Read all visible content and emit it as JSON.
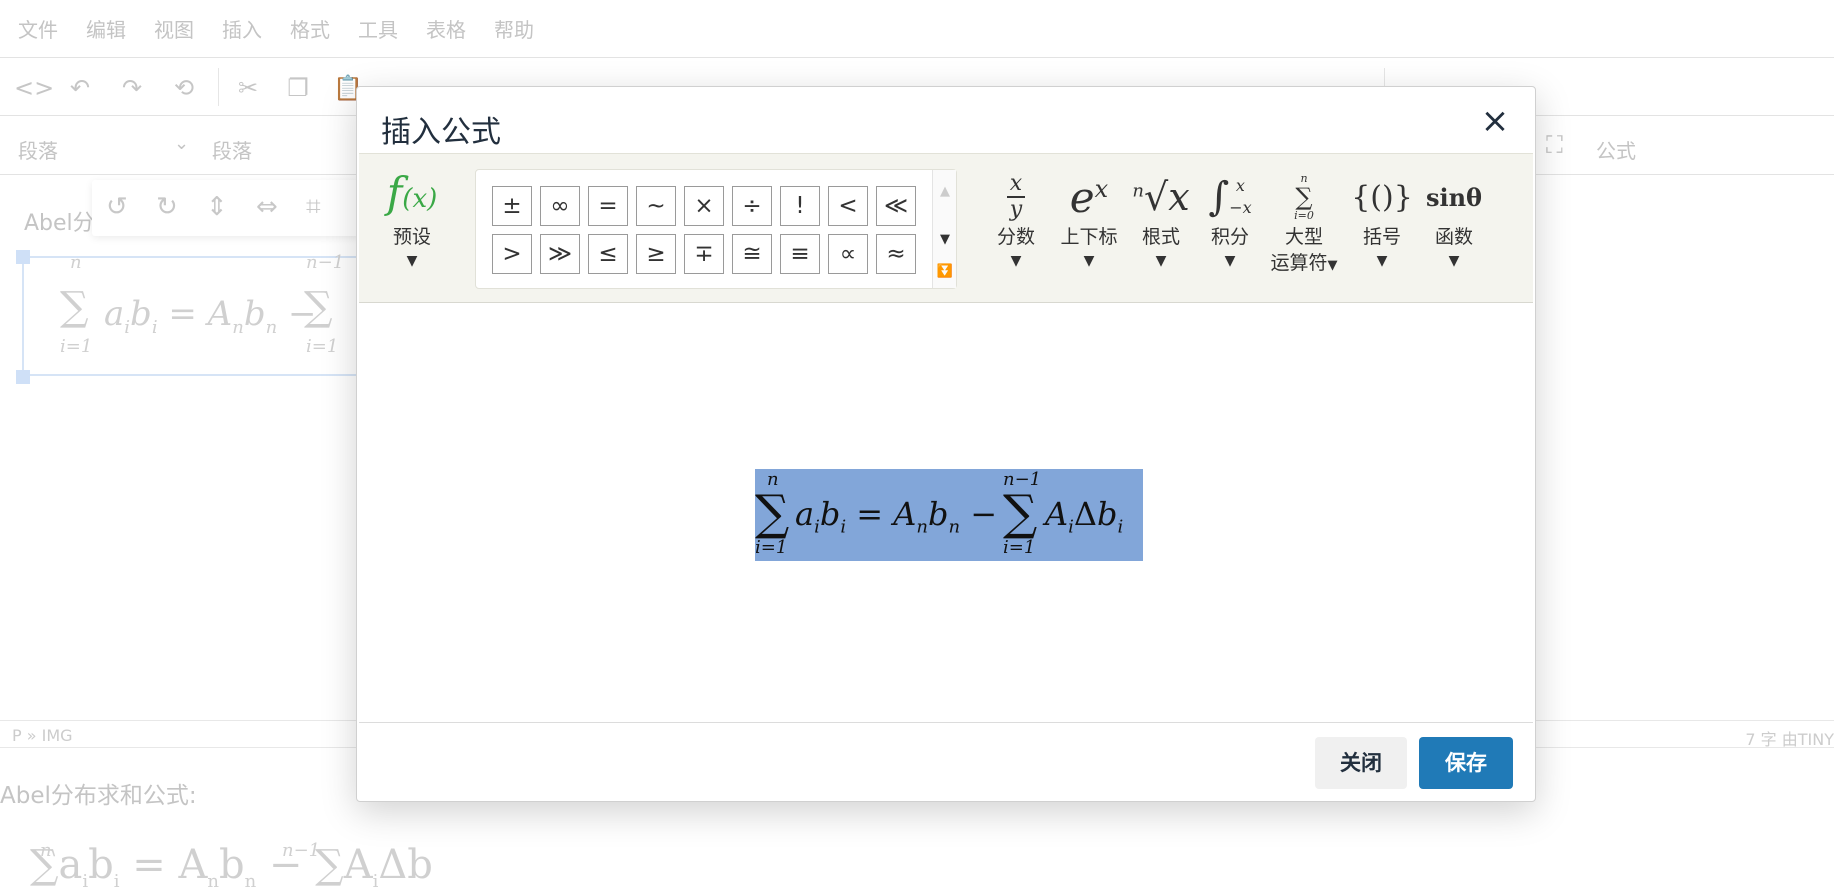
{
  "menubar": {
    "items": [
      "文件",
      "编辑",
      "视图",
      "插入",
      "格式",
      "工具",
      "表格",
      "帮助"
    ]
  },
  "toolbar2": {
    "block_select": "段落",
    "font_select": "段落",
    "formula_label": "公式"
  },
  "editor": {
    "bg_heading": "Abel分",
    "below_text": "Abel分布求和公式:",
    "status_path": "P » IMG",
    "status_right": "7 字  由TINY"
  },
  "dialog": {
    "title": "插入公式",
    "close_icon": "×",
    "preset": {
      "icon_text": "f(x)",
      "label": "预设"
    },
    "symbols": [
      "±",
      "∞",
      "=",
      "∼",
      "×",
      "÷",
      "!",
      "<",
      "≪",
      ">",
      "≫",
      "≤",
      "≥",
      "∓",
      "≅",
      "≡",
      "∝",
      "≈"
    ],
    "categories": [
      {
        "name": "fraction",
        "label": "分数"
      },
      {
        "name": "script",
        "label": "上下标"
      },
      {
        "name": "radical",
        "label": "根式"
      },
      {
        "name": "integral",
        "label": "积分"
      },
      {
        "name": "large-operator",
        "label": "大型",
        "label2": "运算符"
      },
      {
        "name": "bracket",
        "label": "括号"
      },
      {
        "name": "function",
        "label": "函数"
      }
    ],
    "buttons": {
      "close": "关闭",
      "save": "保存"
    }
  }
}
